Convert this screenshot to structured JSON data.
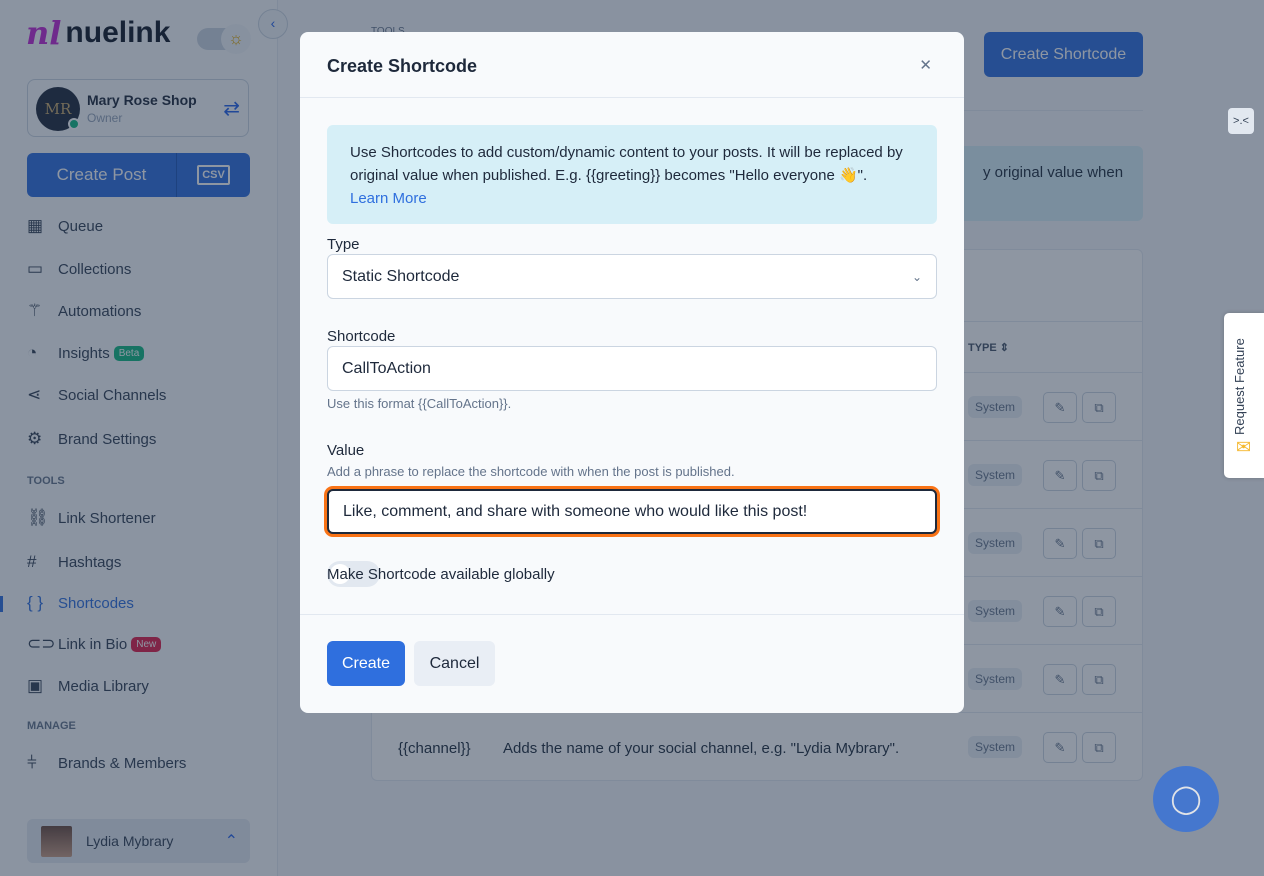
{
  "sidebar": {
    "logo": "nuelink",
    "brand": {
      "name": "Mary Rose Shop",
      "role": "Owner",
      "initials": "MR"
    },
    "create_post": "Create Post",
    "csv": "CSV",
    "items": [
      {
        "label": "Queue",
        "icon": "calendar-icon"
      },
      {
        "label": "Collections",
        "icon": "folder-icon"
      },
      {
        "label": "Automations",
        "icon": "magic-wand-icon"
      },
      {
        "label": "Insights",
        "icon": "pie-chart-icon",
        "badge": "Beta"
      },
      {
        "label": "Social Channels",
        "icon": "share-icon"
      },
      {
        "label": "Brand Settings",
        "icon": "gear-icon"
      }
    ],
    "tools_title": "TOOLS",
    "tools": [
      {
        "label": "Link Shortener"
      },
      {
        "label": "Hashtags"
      },
      {
        "label": "Shortcodes"
      },
      {
        "label": "Link in Bio",
        "badge": "New"
      },
      {
        "label": "Media Library"
      }
    ],
    "manage_title": "MANAGE",
    "manage": [
      {
        "label": "Brands & Members"
      }
    ],
    "user": "Lydia Mybrary"
  },
  "main": {
    "breadcrumb": "TOOLS",
    "create_button": "Create Shortcode",
    "info_tail": "y original value when",
    "type_header": "TYPE",
    "badge": "System",
    "last_row": {
      "code": "{{channel}}",
      "desc": "Adds the name of your social channel, e.g. \"Lydia Mybrary\"."
    }
  },
  "modal": {
    "title": "Create Shortcode",
    "info": "Use Shortcodes to add custom/dynamic content to your posts. It will be replaced by original value when published. E.g. {{greeting}} becomes \"Hello everyone 👋\".",
    "learn_more": "Learn More",
    "type_label": "Type",
    "type_value": "Static Shortcode",
    "shortcode_label": "Shortcode",
    "shortcode_value": "CallToAction",
    "shortcode_hint": "Use this format {{CallToAction}}.",
    "value_label": "Value",
    "value_hint": "Add a phrase to replace the shortcode with when the post is published.",
    "value_value": "Like, comment, and share with someone who would like this post!",
    "global_label": "Make Shortcode available globally",
    "global_enabled": false,
    "create": "Create",
    "cancel": "Cancel"
  },
  "request_feature": "Request Feature",
  "colors": {
    "primary": "#2f6fde",
    "focus": "#f97316",
    "beta": "#10b981",
    "new": "#e11d48"
  }
}
